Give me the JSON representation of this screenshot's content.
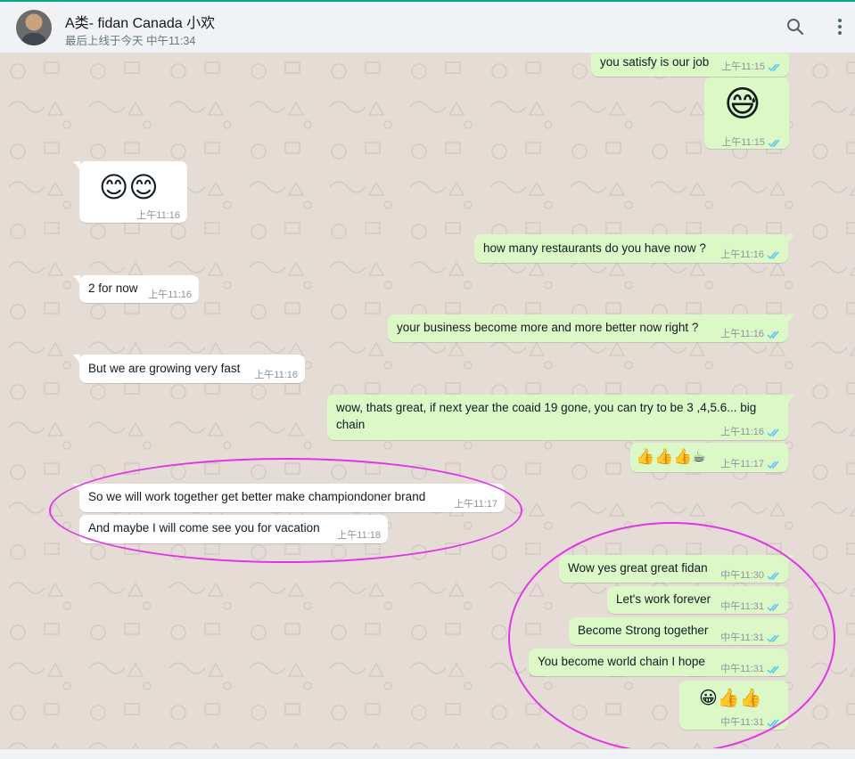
{
  "header": {
    "chat_name": "A类- fidan Canada 小欢",
    "status": "最后上线于今天 中午11:34",
    "icons": [
      "search-icon",
      "menu-icon"
    ]
  },
  "messages": [
    {
      "dir": "out",
      "text": "you satisfy is our job",
      "time": "上午11:15",
      "ticks": "read"
    },
    {
      "dir": "out",
      "text": "😅",
      "time": "上午11:15",
      "ticks": "read"
    },
    {
      "dir": "in",
      "text": "😊😊",
      "time": "上午11:16"
    },
    {
      "dir": "out",
      "text": "how many restaurants do you have now ?",
      "time": "上午11:16",
      "ticks": "read"
    },
    {
      "dir": "in",
      "text": "2 for now",
      "time": "上午11:16"
    },
    {
      "dir": "out",
      "text": "your business become more and more better now right ?",
      "time": "上午11:16",
      "ticks": "read"
    },
    {
      "dir": "in",
      "text": "But we are growing very fast",
      "time": "上午11:16"
    },
    {
      "dir": "out",
      "text_line1": "wow, thats great, if next year the coaid 19 gone, you can try to be 3 ,4,5.6... big",
      "text_line2": "chain",
      "time": "上午11:16",
      "ticks": "read"
    },
    {
      "dir": "out",
      "text": "👍👍👍☕",
      "time": "上午11:17",
      "ticks": "read"
    },
    {
      "dir": "in",
      "text": "So we will work together get better make championdoner brand",
      "time": "上午11:17"
    },
    {
      "dir": "in",
      "text": "And maybe I will come see you for vacation",
      "time": "上午11:18"
    },
    {
      "dir": "out",
      "text": "Wow yes great great fidan",
      "time": "中午11:30",
      "ticks": "read"
    },
    {
      "dir": "out",
      "text": "Let's work forever",
      "time": "中午11:31",
      "ticks": "read"
    },
    {
      "dir": "out",
      "text": "Become Strong together",
      "time": "中午11:31",
      "ticks": "read"
    },
    {
      "dir": "out",
      "text": "You become world chain I hope",
      "time": "中午11:31",
      "ticks": "read"
    },
    {
      "dir": "out",
      "text": "😀👍👍",
      "time": "中午11:31",
      "ticks": "read"
    }
  ],
  "colors": {
    "outgoing_bubble": "#dcf8c6",
    "incoming_bubble": "#ffffff",
    "read_tick": "#4fc3f7",
    "annotation_circle": "#e135e6"
  }
}
